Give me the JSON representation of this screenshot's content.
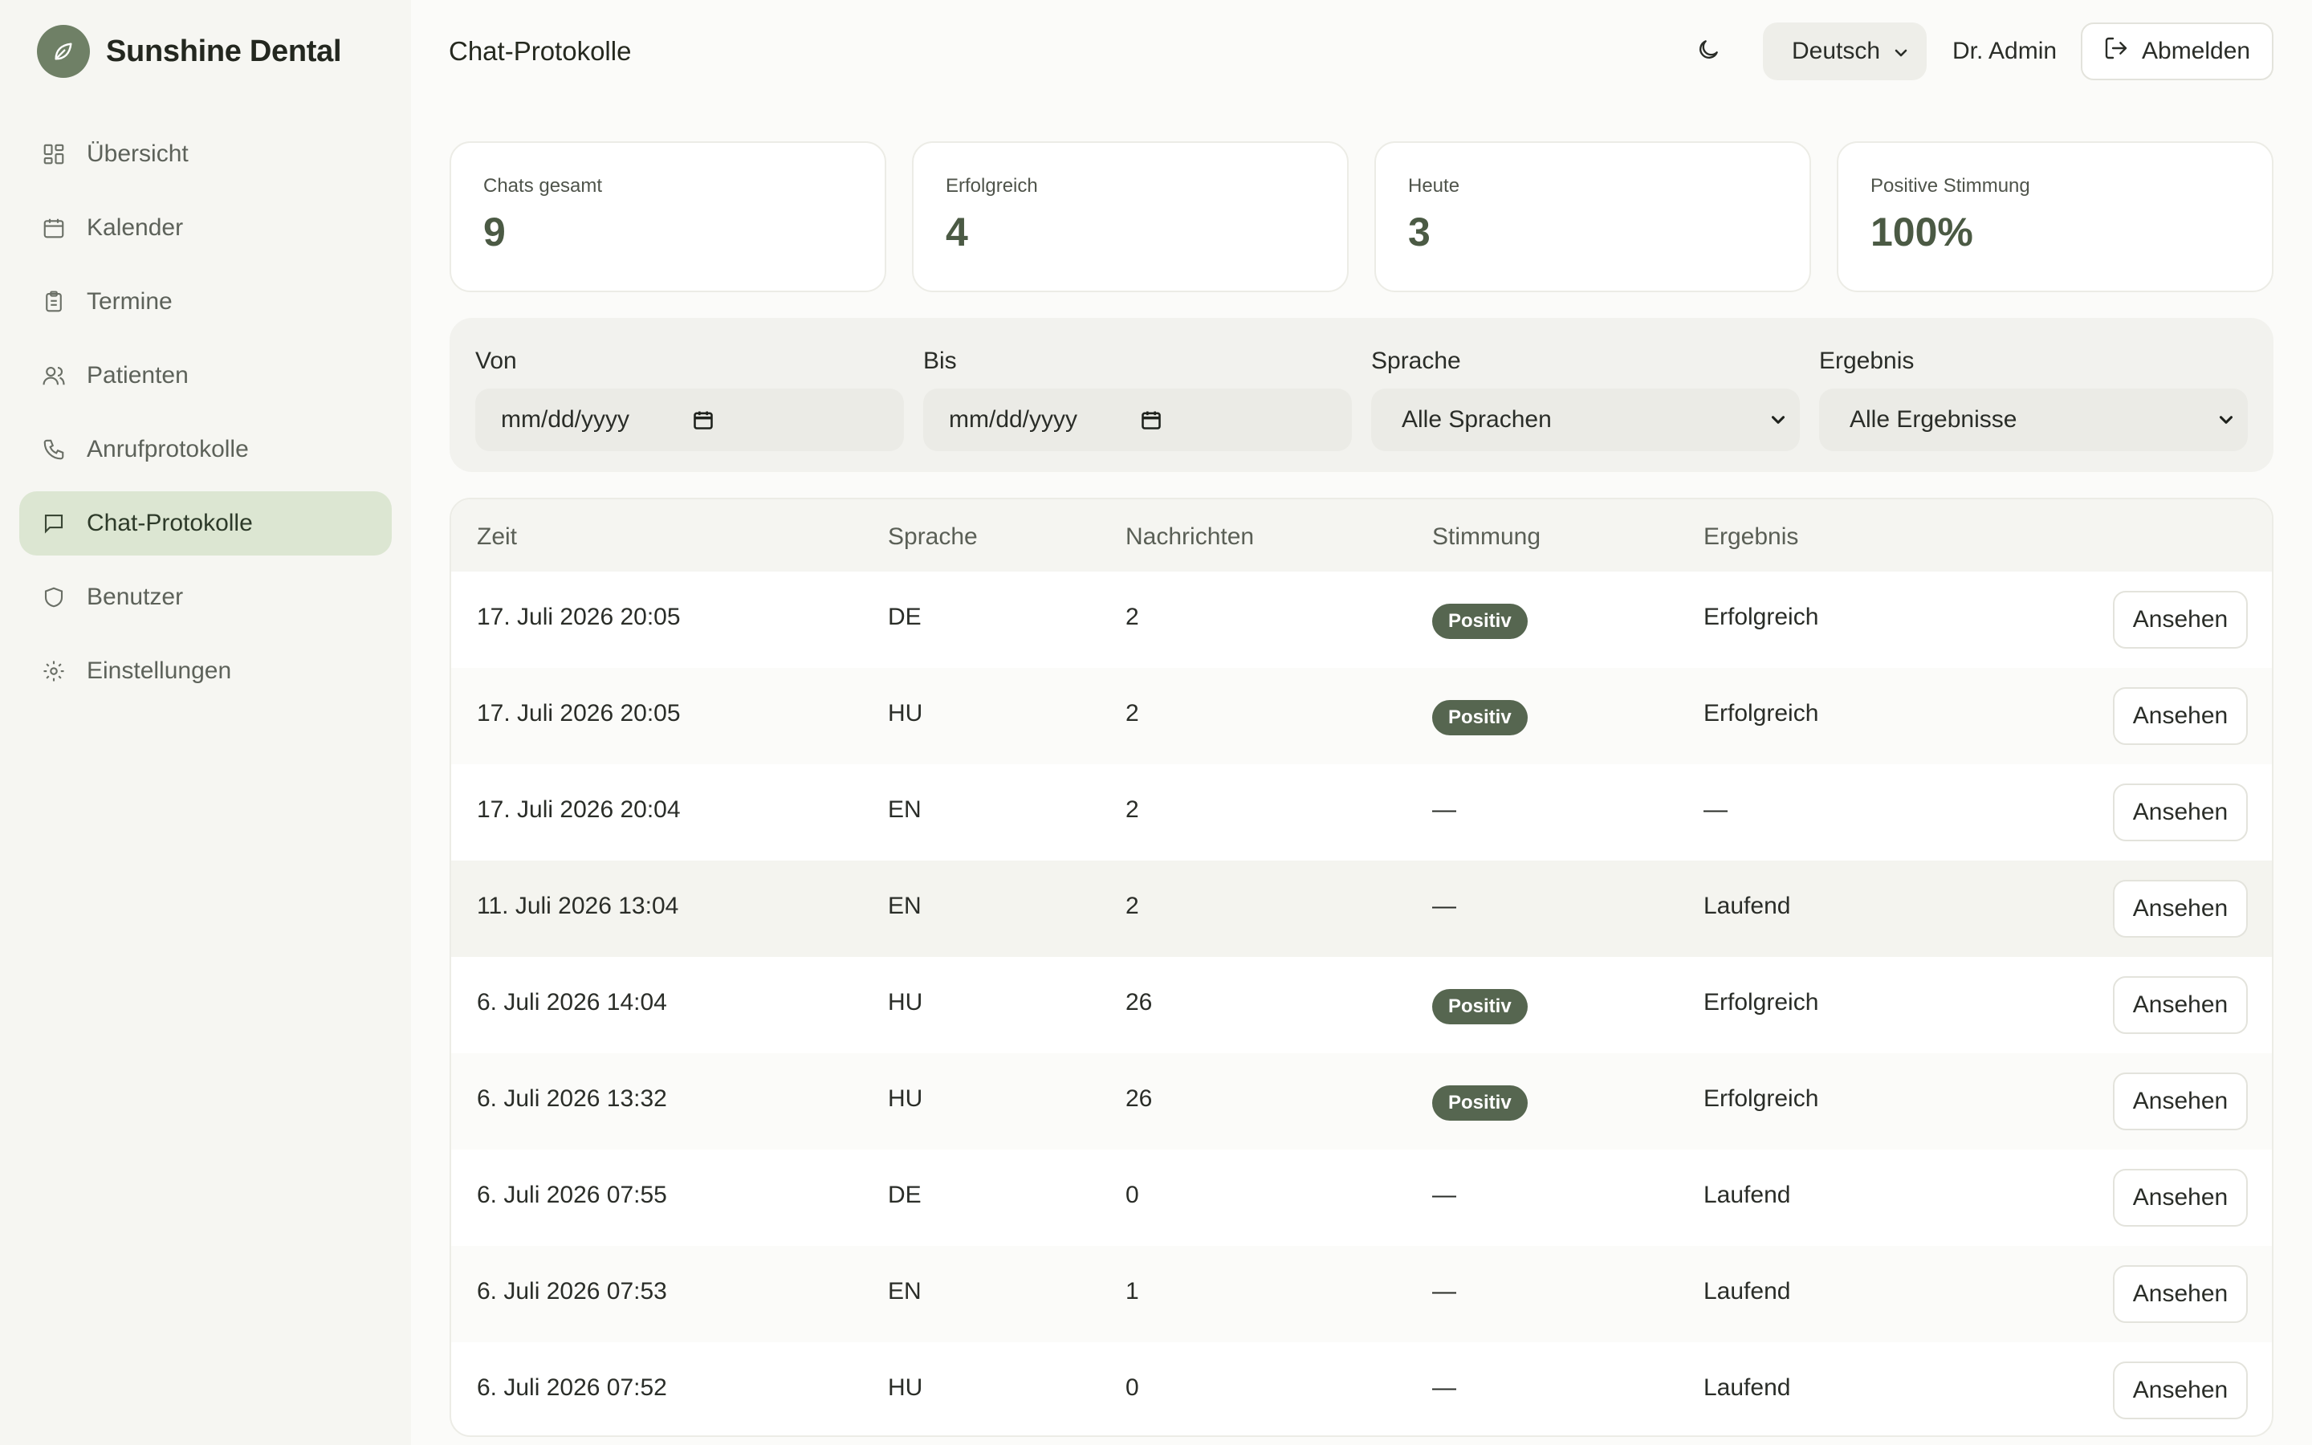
{
  "brand": {
    "name": "Sunshine Dental",
    "logo_icon": "leaf-icon",
    "logo_color": "#6f8066"
  },
  "sidebar": {
    "items": [
      {
        "label": "Übersicht",
        "icon": "dashboard-icon",
        "active": false
      },
      {
        "label": "Kalender",
        "icon": "calendar-icon",
        "active": false
      },
      {
        "label": "Termine",
        "icon": "clipboard-icon",
        "active": false
      },
      {
        "label": "Patienten",
        "icon": "users-icon",
        "active": false
      },
      {
        "label": "Anrufprotokolle",
        "icon": "phone-icon",
        "active": false
      },
      {
        "label": "Chat-Protokolle",
        "icon": "message-icon",
        "active": true
      },
      {
        "label": "Benutzer",
        "icon": "shield-icon",
        "active": false
      },
      {
        "label": "Einstellungen",
        "icon": "gear-icon",
        "active": false
      }
    ]
  },
  "header": {
    "title": "Chat-Protokolle",
    "theme_icon": "moon-icon",
    "language": "Deutsch",
    "user": "Dr. Admin",
    "logout_label": "Abmelden"
  },
  "stats": [
    {
      "label": "Chats gesamt",
      "value": "9"
    },
    {
      "label": "Erfolgreich",
      "value": "4"
    },
    {
      "label": "Heute",
      "value": "3"
    },
    {
      "label": "Positive Stimmung",
      "value": "100%"
    }
  ],
  "filters": {
    "from": {
      "label": "Von",
      "value": "mm/dd/yyyy"
    },
    "to": {
      "label": "Bis",
      "value": "mm/dd/yyyy"
    },
    "language": {
      "label": "Sprache",
      "value": "Alle Sprachen"
    },
    "result": {
      "label": "Ergebnis",
      "value": "Alle Ergebnisse"
    }
  },
  "table": {
    "columns": [
      "Zeit",
      "Sprache",
      "Nachrichten",
      "Stimmung",
      "Ergebnis"
    ],
    "view_label": "Ansehen",
    "rows": [
      {
        "time": "17. Juli 2026 20:05",
        "lang": "DE",
        "messages": "2",
        "mood": "Positiv",
        "result": "Erfolgreich"
      },
      {
        "time": "17. Juli 2026 20:05",
        "lang": "HU",
        "messages": "2",
        "mood": "Positiv",
        "result": "Erfolgreich"
      },
      {
        "time": "17. Juli 2026 20:04",
        "lang": "EN",
        "messages": "2",
        "mood": "—",
        "result": "—"
      },
      {
        "time": "11. Juli 2026 13:04",
        "lang": "EN",
        "messages": "2",
        "mood": "—",
        "result": "Laufend"
      },
      {
        "time": "6. Juli 2026 14:04",
        "lang": "HU",
        "messages": "26",
        "mood": "Positiv",
        "result": "Erfolgreich"
      },
      {
        "time": "6. Juli 2026 13:32",
        "lang": "HU",
        "messages": "26",
        "mood": "Positiv",
        "result": "Erfolgreich"
      },
      {
        "time": "6. Juli 2026 07:55",
        "lang": "DE",
        "messages": "0",
        "mood": "—",
        "result": "Laufend"
      },
      {
        "time": "6. Juli 2026 07:53",
        "lang": "EN",
        "messages": "1",
        "mood": "—",
        "result": "Laufend"
      },
      {
        "time": "6. Juli 2026 07:52",
        "lang": "HU",
        "messages": "0",
        "mood": "—",
        "result": "Laufend"
      }
    ]
  },
  "colors": {
    "accent": "#566650",
    "active_nav_bg": "#dce6d2",
    "stat_value": "#4b5a44"
  }
}
